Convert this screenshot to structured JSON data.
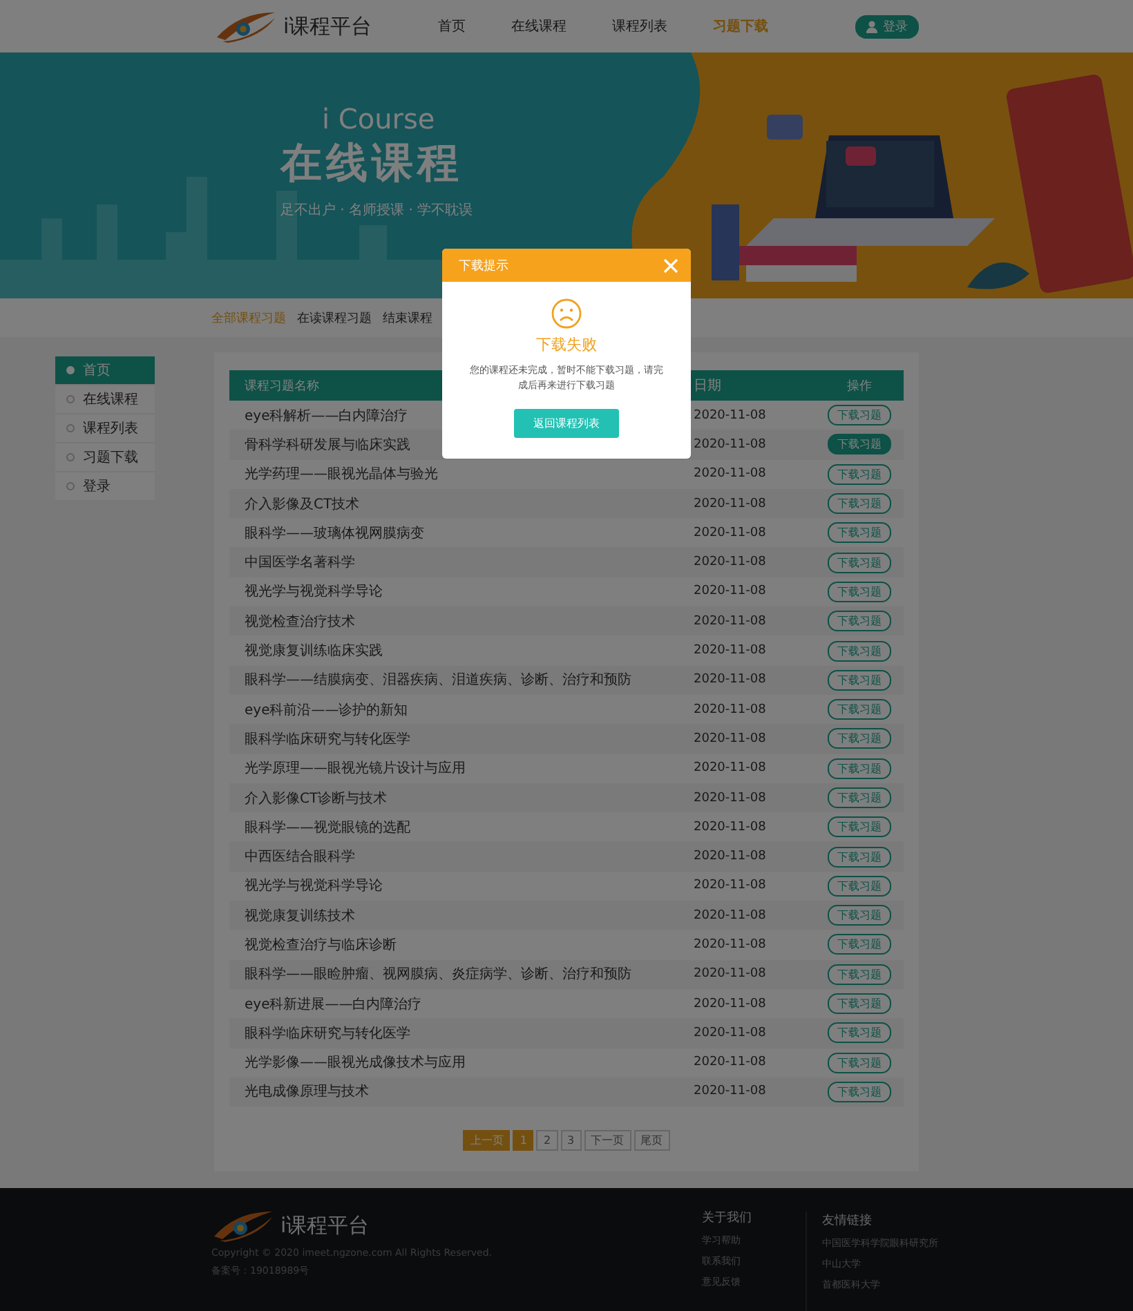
{
  "header": {
    "logo_text": "i课程平台",
    "nav": [
      {
        "label": "首页",
        "selected": false
      },
      {
        "label": "在线课程",
        "selected": false
      },
      {
        "label": "课程列表",
        "selected": false
      },
      {
        "label": "习题下载",
        "selected": true
      }
    ],
    "login_button": "登录"
  },
  "banner": {
    "subtitle": "i Course",
    "title": "在线课程",
    "tagline": "足不出户 · 名师授课 · 学不耽误"
  },
  "filter_tabs": [
    {
      "label": "全部课程习题",
      "selected": true
    },
    {
      "label": "在读课程习题",
      "selected": false
    },
    {
      "label": "结束课程",
      "selected": false
    }
  ],
  "sidebar": {
    "items": [
      {
        "label": "首页",
        "selected": true
      },
      {
        "label": "在线课程",
        "selected": false
      },
      {
        "label": "课程列表",
        "selected": false
      },
      {
        "label": "习题下载",
        "selected": false
      },
      {
        "label": "登录",
        "selected": false
      }
    ]
  },
  "table": {
    "columns": [
      "课程习题名称",
      "日期",
      "操作"
    ],
    "rows": [
      {
        "name": "eye科解析——白内障治疗",
        "date": "2020-11-08",
        "action": "下载习题",
        "highlighted": false
      },
      {
        "name": "骨科学科研发展与临床实践",
        "date": "2020-11-08",
        "action": "下载习题",
        "highlighted": true
      },
      {
        "name": "光学药理——眼视光晶体与验光",
        "date": "2020-11-08",
        "action": "下载习题",
        "highlighted": false
      },
      {
        "name": "介入影像及CT技术",
        "date": "2020-11-08",
        "action": "下载习题",
        "highlighted": false
      },
      {
        "name": "眼科学——玻璃体视网膜病变",
        "date": "2020-11-08",
        "action": "下载习题",
        "highlighted": false
      },
      {
        "name": "中国医学名著科学",
        "date": "2020-11-08",
        "action": "下载习题",
        "highlighted": false
      },
      {
        "name": "视光学与视觉科学导论",
        "date": "2020-11-08",
        "action": "下载习题",
        "highlighted": false
      },
      {
        "name": "视觉检查治疗技术",
        "date": "2020-11-08",
        "action": "下载习题",
        "highlighted": false
      },
      {
        "name": "视觉康复训练临床实践",
        "date": "2020-11-08",
        "action": "下载习题",
        "highlighted": false
      },
      {
        "name": "眼科学——结膜病变、泪器疾病、泪道疾病、诊断、治疗和预防",
        "date": "2020-11-08",
        "action": "下载习题",
        "highlighted": false
      },
      {
        "name": "eye科前沿——诊护的新知",
        "date": "2020-11-08",
        "action": "下载习题",
        "highlighted": false
      },
      {
        "name": "眼科学临床研究与转化医学",
        "date": "2020-11-08",
        "action": "下载习题",
        "highlighted": false
      },
      {
        "name": "光学原理——眼视光镜片设计与应用",
        "date": "2020-11-08",
        "action": "下载习题",
        "highlighted": false
      },
      {
        "name": "介入影像CT诊断与技术",
        "date": "2020-11-08",
        "action": "下载习题",
        "highlighted": false
      },
      {
        "name": "眼科学——视觉眼镜的选配",
        "date": "2020-11-08",
        "action": "下载习题",
        "highlighted": false
      },
      {
        "name": "中西医结合眼科学",
        "date": "2020-11-08",
        "action": "下载习题",
        "highlighted": false
      },
      {
        "name": "视光学与视觉科学导论",
        "date": "2020-11-08",
        "action": "下载习题",
        "highlighted": false
      },
      {
        "name": "视觉康复训练技术",
        "date": "2020-11-08",
        "action": "下载习题",
        "highlighted": false
      },
      {
        "name": "视觉检查治疗与临床诊断",
        "date": "2020-11-08",
        "action": "下载习题",
        "highlighted": false
      },
      {
        "name": "眼科学——眼睑肿瘤、视网膜病、炎症病学、诊断、治疗和预防",
        "date": "2020-11-08",
        "action": "下载习题",
        "highlighted": false
      },
      {
        "name": "eye科新进展——白内障治疗",
        "date": "2020-11-08",
        "action": "下载习题",
        "highlighted": false
      },
      {
        "name": "眼科学临床研究与转化医学",
        "date": "2020-11-08",
        "action": "下载习题",
        "highlighted": false
      },
      {
        "name": "光学影像——眼视光成像技术与应用",
        "date": "2020-11-08",
        "action": "下载习题",
        "highlighted": false
      },
      {
        "name": "光电成像原理与技术",
        "date": "2020-11-08",
        "action": "下载习题",
        "highlighted": false
      }
    ]
  },
  "pagination": [
    {
      "label": "上一页",
      "selected": true
    },
    {
      "label": "1",
      "selected": true
    },
    {
      "label": "2",
      "selected": false
    },
    {
      "label": "3",
      "selected": false
    },
    {
      "label": "下一页",
      "selected": false
    },
    {
      "label": "尾页",
      "selected": false
    }
  ],
  "modal": {
    "title": "下载提示",
    "heading": "下载失败",
    "message": "您的课程还未完成，暂时不能下载习题，请完成后再来进行下载习题",
    "button": "返回课程列表"
  },
  "footer": {
    "logo_text": "i课程平台",
    "copyright": "Copyright © 2020 imeet.ngzone.com All Rights Reserved.",
    "icp": "备案号：19018989号",
    "columns": [
      {
        "title": "关于我们",
        "links": [
          "学习帮助",
          "联系我们",
          "意见反馈"
        ]
      },
      {
        "title": "友情链接",
        "links": [
          "中国医学科学院眼科研究所",
          "中山大学",
          "首都医科大学"
        ]
      }
    ]
  }
}
